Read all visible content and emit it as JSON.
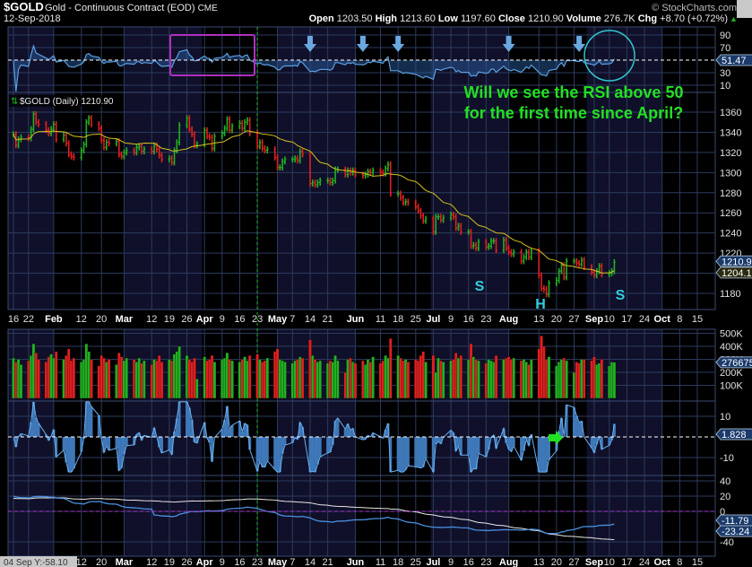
{
  "header": {
    "symbol": "$GOLD",
    "name": "Gold - Continuous Contract (EOD)",
    "exchange": "CME",
    "date": "12-Sep-2018",
    "copyright": "© StockCharts.com",
    "quote": [
      {
        "label": "Open",
        "value": "1203.50"
      },
      {
        "label": "High",
        "value": "1213.60"
      },
      {
        "label": "Low",
        "value": "1197.60"
      },
      {
        "label": "Close",
        "value": "1210.90"
      },
      {
        "label": "Volume",
        "value": "276.7K"
      },
      {
        "label": "Chg",
        "value": "+8.70 (+0.72%)"
      }
    ],
    "chg_arrow": "▲"
  },
  "colors": {
    "up": "#22b022",
    "down": "#e02020",
    "ma": "#d8c020",
    "rsi": "#5aa0e0",
    "annotation": "#22e022",
    "pattern": "#30d0e0",
    "box": "#b030c0",
    "navy": "#10102a",
    "grid": "#2c3b5e"
  },
  "annotation": {
    "line1": "Will we see the RSI above 50",
    "line2": "for the first time since April?",
    "pattern_left_shoulder": "S",
    "pattern_head": "H",
    "pattern_right_shoulder": "S"
  },
  "price_legend": "$GOLD (Daily) 1210.90",
  "crosshair_readout": "04 Sep Y:-58.10",
  "chart_data": {
    "type": "bar",
    "first_date": "2018-01-16",
    "last_date": "2018-09-12",
    "closes": [
      1338,
      1327,
      1333,
      1335,
      1334,
      1343,
      1358,
      1350,
      1348,
      1342,
      1339,
      1343,
      1348,
      1333,
      1337,
      1329,
      1318,
      1316,
      1315,
      1322,
      1328,
      1350,
      1354,
      1348,
      1344,
      1332,
      1325,
      1330,
      1329,
      1331,
      1318,
      1316,
      1320,
      1322,
      1320,
      1325,
      1326,
      1321,
      1323,
      1321,
      1327,
      1323,
      1317,
      1313,
      1314,
      1310,
      1322,
      1330,
      1347,
      1354,
      1343,
      1338,
      1327,
      1328,
      1342,
      1336,
      1335,
      1324,
      1336,
      1339,
      1344,
      1353,
      1342,
      1346,
      1349,
      1344,
      1350,
      1352,
      1339,
      1326,
      1330,
      1324,
      1322,
      1323,
      1315,
      1305,
      1305,
      1311,
      1313,
      1313,
      1314,
      1312,
      1321,
      1318,
      1289,
      1290,
      1288,
      1290,
      1292,
      1292,
      1290,
      1292,
      1303,
      1303,
      1298,
      1302,
      1300,
      1302,
      1298,
      1297,
      1298,
      1301,
      1300,
      1302,
      1300,
      1299,
      1304,
      1308,
      1279,
      1279,
      1275,
      1270,
      1271,
      1270,
      1266,
      1262,
      1257,
      1252,
      1254,
      1241,
      1256,
      1256,
      1253,
      1255,
      1258,
      1256,
      1245,
      1247,
      1241,
      1241,
      1227,
      1228,
      1225,
      1231,
      1226,
      1227,
      1232,
      1232,
      1223,
      1233,
      1225,
      1221,
      1219,
      1221,
      1212,
      1216,
      1221,
      1216,
      1222,
      1198,
      1185,
      1184,
      1179,
      1190,
      1193,
      1202,
      1208,
      1196,
      1212,
      1212,
      1210,
      1209,
      1213,
      1206,
      1201,
      1198,
      1202,
      1207,
      1199,
      1200,
      1202,
      1210.9
    ],
    "volume_k": [
      310,
      280,
      300,
      260,
      290,
      330,
      420,
      350,
      300,
      280,
      320,
      340,
      310,
      360,
      300,
      330,
      380,
      290,
      310,
      280,
      300,
      420,
      360,
      300,
      250,
      330,
      310,
      280,
      300,
      260,
      350,
      320,
      290,
      310,
      300,
      280,
      310,
      270,
      290,
      260,
      300,
      290,
      330,
      280,
      300,
      290,
      340,
      360,
      400,
      330,
      300,
      280,
      310,
      150,
      320,
      290,
      300,
      330,
      280,
      300,
      310,
      350,
      300,
      290,
      280,
      300,
      320,
      290,
      330,
      340,
      300,
      280,
      290,
      310,
      360,
      380,
      300,
      290,
      280,
      270,
      290,
      300,
      320,
      310,
      450,
      330,
      300,
      280,
      290,
      270,
      290,
      280,
      330,
      290,
      200,
      300,
      310,
      280,
      270,
      290,
      260,
      300,
      280,
      320,
      270,
      290,
      330,
      310,
      460,
      330,
      310,
      290,
      300,
      280,
      300,
      290,
      330,
      360,
      280,
      330,
      200,
      310,
      290,
      280,
      290,
      300,
      350,
      310,
      330,
      300,
      420,
      320,
      300,
      290,
      270,
      300,
      290,
      280,
      330,
      300,
      310,
      320,
      300,
      310,
      290,
      300,
      280,
      260,
      300,
      380,
      480,
      400,
      300,
      320,
      250,
      280,
      300,
      310,
      290,
      200,
      280,
      270,
      300,
      300,
      290,
      320,
      260,
      270,
      300,
      250,
      280,
      277
    ],
    "price_axis": {
      "ticks": [
        1180,
        1200,
        1220,
        1240,
        1260,
        1280,
        1300,
        1320,
        1340,
        1360
      ],
      "labels": [
        "1180",
        "",
        "1220",
        "1240",
        "1260",
        "1280",
        "1300",
        "1320",
        "1340",
        "1360"
      ],
      "last_label": "1210.90",
      "ma_label": "1204.12",
      "ma_period": 20
    },
    "rsi": {
      "period": 14,
      "ticks": [
        "90",
        "70",
        "30",
        "10"
      ],
      "tick_values": [
        90,
        70,
        30,
        10
      ],
      "reference": 50,
      "last_label": "51.47"
    },
    "volume_axis": {
      "ticks": [
        "500K",
        "400K",
        "300K",
        "200K",
        "100K"
      ],
      "tick_values": [
        500,
        400,
        300,
        200,
        100
      ],
      "last_label": "276675"
    },
    "oscillator": {
      "ticks": [
        "10",
        "-10"
      ],
      "tick_values": [
        10,
        -10
      ],
      "last_label": "1.828"
    },
    "lower_panel": {
      "ticks": [
        "40",
        "20",
        "0",
        "-40"
      ],
      "tick_values": [
        40,
        20,
        0,
        -40
      ],
      "last_labels": [
        "-11.79",
        "-23.24"
      ]
    },
    "x_ticks": [
      {
        "label": "16",
        "date": "2018-01-16"
      },
      {
        "label": "22",
        "date": "2018-01-22"
      },
      {
        "label": "Feb",
        "date": "2018-02-01",
        "bold": true
      },
      {
        "label": "12",
        "date": "2018-02-12"
      },
      {
        "label": "20",
        "date": "2018-02-20"
      },
      {
        "label": "Mar",
        "date": "2018-03-01",
        "bold": true
      },
      {
        "label": "12",
        "date": "2018-03-12"
      },
      {
        "label": "19",
        "date": "2018-03-19"
      },
      {
        "label": "26",
        "date": "2018-03-26"
      },
      {
        "label": "Apr",
        "date": "2018-04-02",
        "bold": true
      },
      {
        "label": "9",
        "date": "2018-04-09"
      },
      {
        "label": "16",
        "date": "2018-04-16"
      },
      {
        "label": "23",
        "date": "2018-04-23"
      },
      {
        "label": "May",
        "date": "2018-05-01",
        "bold": true
      },
      {
        "label": "7",
        "date": "2018-05-07"
      },
      {
        "label": "14",
        "date": "2018-05-14"
      },
      {
        "label": "21",
        "date": "2018-05-21"
      },
      {
        "label": "Jun",
        "date": "2018-06-01",
        "bold": true
      },
      {
        "label": "11",
        "date": "2018-06-11"
      },
      {
        "label": "18",
        "date": "2018-06-18"
      },
      {
        "label": "25",
        "date": "2018-06-25"
      },
      {
        "label": "Jul",
        "date": "2018-07-02",
        "bold": true
      },
      {
        "label": "9",
        "date": "2018-07-09"
      },
      {
        "label": "16",
        "date": "2018-07-16"
      },
      {
        "label": "23",
        "date": "2018-07-23"
      },
      {
        "label": "Aug",
        "date": "2018-08-01",
        "bold": true
      },
      {
        "label": "13",
        "date": "2018-08-13"
      },
      {
        "label": "20",
        "date": "2018-08-20"
      },
      {
        "label": "27",
        "date": "2018-08-27"
      },
      {
        "label": "Sep",
        "date": "2018-09-04",
        "bold": true
      },
      {
        "label": "10",
        "date": "2018-09-10"
      },
      {
        "label": "17",
        "date": "2018-09-17"
      },
      {
        "label": "24",
        "date": "2018-09-24"
      },
      {
        "label": "Oct",
        "date": "2018-10-01",
        "bold": true
      },
      {
        "label": "8",
        "date": "2018-10-08"
      },
      {
        "label": "15",
        "date": "2018-10-15"
      }
    ],
    "month_bands": [
      "2018-01-01",
      "2018-02-01",
      "2018-03-01",
      "2018-04-01",
      "2018-05-01",
      "2018-06-01",
      "2018-07-01",
      "2018-08-01",
      "2018-09-01",
      "2018-10-01",
      "2018-11-01"
    ],
    "marker_date": "2018-04-23",
    "rsi_arrow_dates": [
      "2018-05-14",
      "2018-06-04",
      "2018-06-18",
      "2018-08-01",
      "2018-08-29"
    ]
  }
}
